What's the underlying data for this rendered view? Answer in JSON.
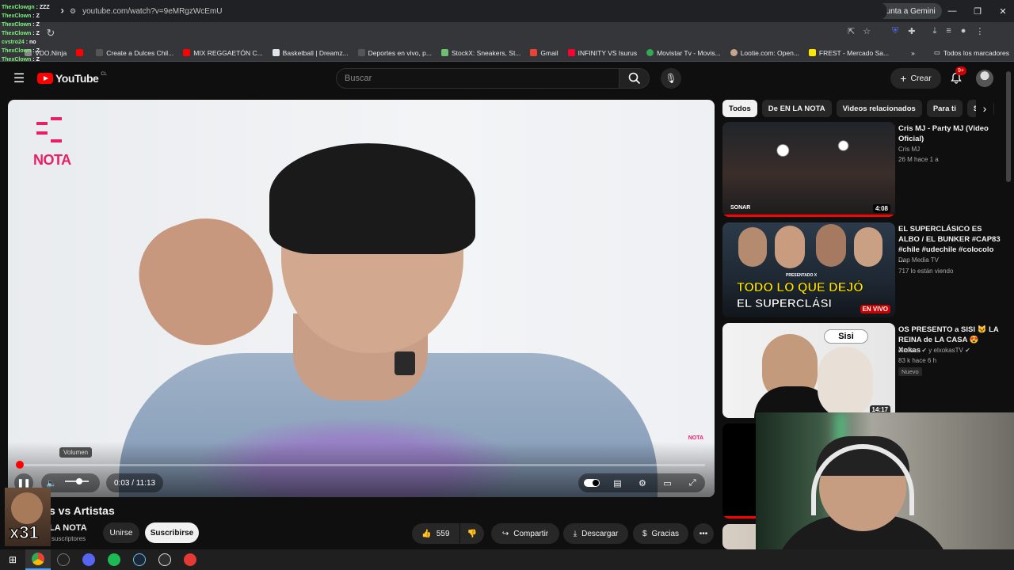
{
  "chat": [
    {
      "user": "ThexClowgn",
      "msg": "ZZZ"
    },
    {
      "user": "ThexClown",
      "msg": "Z"
    },
    {
      "user": "ThexClown",
      "msg": "Z"
    },
    {
      "user": "ThexClown",
      "msg": "Z"
    },
    {
      "user": "cvstro24",
      "msg": "no"
    },
    {
      "user": "ThexClown",
      "msg": "Z"
    },
    {
      "user": "ThexClown",
      "msg": "Z"
    }
  ],
  "browser": {
    "gemini_label": "Pregunta a Gemini",
    "url": "youtube.com/watch?v=9eMRgzWcEmU",
    "bookmarks": [
      "VDO.Ninja",
      "",
      "Create a Dulces Chil...",
      "MIX REGGAETÓN C...",
      "Basketball | Dreamz...",
      "Deportes en vivo, p...",
      "StockX: Sneakers, St...",
      "Gmail",
      "INFINITY VS Isurus",
      "Movistar Tv - Movis...",
      "Lootie.com: Open...",
      "FREST - Mercado Sa..."
    ],
    "all_bookmarks": "Todos los marcadores"
  },
  "youtube": {
    "logo": "YouTube",
    "country": "CL",
    "search_placeholder": "Buscar",
    "create_label": "Crear",
    "notif_count": "9+"
  },
  "player": {
    "logo_text": "NOTA",
    "watermark": "NOTA",
    "tooltip": "Volumen",
    "time": "0:03 / 11:13",
    "progress_fraction": 0.004,
    "volume_fraction": 0.6
  },
  "video": {
    "title_partial": "s vs Artistas",
    "channel": "LA NOTA",
    "subs": "3 k suscriptores",
    "join": "Unirse",
    "subscribe": "Suscribirse",
    "likes": "559",
    "share": "Compartir",
    "download": "Descargar",
    "thanks": "Gracias",
    "overlay_x": "x31"
  },
  "chips": [
    "Todos",
    "De EN LA NOTA",
    "Videos relacionados",
    "Para ti",
    "Sub"
  ],
  "recs": [
    {
      "title": "Cris MJ - Party MJ (Video Oficial)",
      "channel": "Cris MJ",
      "meta": "26 M  hace 1 a",
      "duration": "4:08",
      "extra": ""
    },
    {
      "title": "EL SUPERCLÁSICO ES ALBO / EL BUNKER #CAP83 #chile #udechile #colocolo ...",
      "channel": "Dap Media TV",
      "meta": "717 lo están viendo",
      "duration": "EN VIVO",
      "extra": ""
    },
    {
      "title": "OS PRESENTO a SISI 🐱 LA REINA de LA CASA 😍 Xokas",
      "channel": "elxokas ✔ y elxokasTV ✔",
      "meta": "83 k  hace 6 h",
      "duration": "14:17",
      "extra": "Nuevo"
    }
  ],
  "thumb_texts": {
    "rec1_brand": "SONAR",
    "rec2_line1": "TODO LO QUE DEJÓ",
    "rec2_line2": "EL SUPERCLÁSI",
    "rec2_presented": "PRESENTADO X",
    "rec3_badge": "Sisi"
  },
  "colors": {
    "yt_red": "#ff0000",
    "nota_pink": "#e91e63",
    "bg": "#0f0f0f"
  }
}
